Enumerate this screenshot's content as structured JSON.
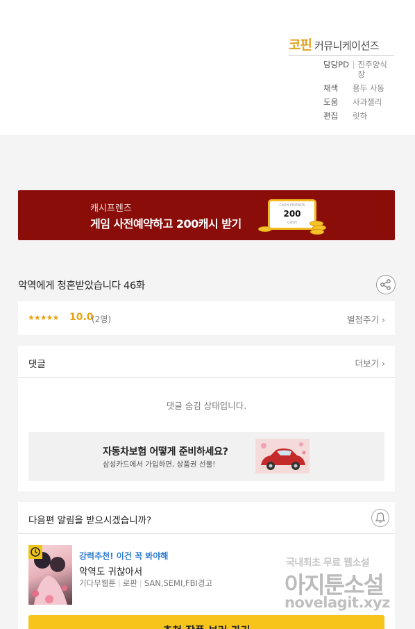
{
  "credits": {
    "brand_main": "코핀",
    "brand_sub": "커뮤니케이션즈",
    "rows": [
      {
        "role": "담당PD",
        "name": "진주양식장",
        "sep": "|"
      },
      {
        "role": "채색",
        "name": "용두 사동",
        "sep": ""
      },
      {
        "role": "도움",
        "name": "사과젤리",
        "sep": ""
      },
      {
        "role": "편집",
        "name": "릿하",
        "sep": ""
      }
    ]
  },
  "banner": {
    "small": "캐시프렌즈",
    "big": "게임 사전예약하고 200캐시 받기",
    "card_tiny": "CASH FRIENDS",
    "card_amount": "200",
    "card_unit": "CASH",
    "bg_color": "#8a0d0a"
  },
  "episode": {
    "title": "악역에게 청혼받았습니다 46화",
    "share_icon": "share-icon"
  },
  "rating": {
    "stars": "★★★★★",
    "score": "10.0",
    "count": "(2명)",
    "rate_link": "별점주기",
    "chevron": "›"
  },
  "comments": {
    "title": "댓글",
    "more": "더보기",
    "chevron": "›",
    "hidden_msg": "댓글 숨김 상태입니다.",
    "ad_title": "자동차보험 어떻게 준비하세요?",
    "ad_sub": "삼성카드에서 가입하면, 상품권 선물!"
  },
  "next": {
    "title": "다음편 알림을 받으시겠습니까?",
    "bell_icon": "bell-icon",
    "rec_label": "강력추천! 이건 꼭 봐야해",
    "rec_title": "악역도 귀찮아서",
    "rec_meta": [
      "기다무웹툰",
      "로판",
      "SAN,SEMI,FBI경고"
    ],
    "cta": "추천 작품 보러 가기",
    "accent": "#f7c41b"
  },
  "watermark": {
    "line1": "국내최초 무료 웹소설",
    "line2": "아지툰소설",
    "line3": "novelagit.xyz"
  }
}
